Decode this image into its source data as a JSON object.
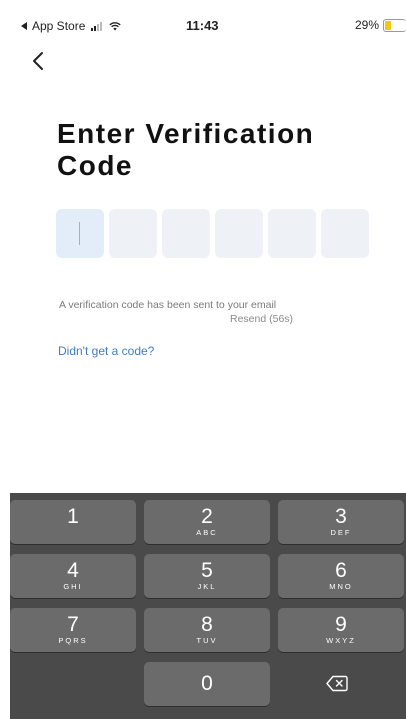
{
  "status_bar": {
    "back_app": "App Store",
    "time": "11:43",
    "battery": "29%",
    "battery_level": 0.29
  },
  "title": "Enter Verification Code",
  "code_length": 6,
  "info_text": "A verification code has been sent to your email",
  "resend_text": "Resend (56s)",
  "no_code_link": "Didn't get a code?",
  "keypad": {
    "keys": [
      {
        "num": "1",
        "letters": ""
      },
      {
        "num": "2",
        "letters": "ABC"
      },
      {
        "num": "3",
        "letters": "DEF"
      },
      {
        "num": "4",
        "letters": "GHI"
      },
      {
        "num": "5",
        "letters": "JKL"
      },
      {
        "num": "6",
        "letters": "MNO"
      },
      {
        "num": "7",
        "letters": "PQRS"
      },
      {
        "num": "8",
        "letters": "TUV"
      },
      {
        "num": "9",
        "letters": "WXYZ"
      },
      {
        "num": "0",
        "letters": ""
      }
    ]
  },
  "colors": {
    "accent": "#3f7dc4",
    "code_box": "#eef2f7",
    "keypad_bg": "#4a4a4a",
    "key_bg": "#6b6b6b",
    "battery": "#f5c518"
  }
}
